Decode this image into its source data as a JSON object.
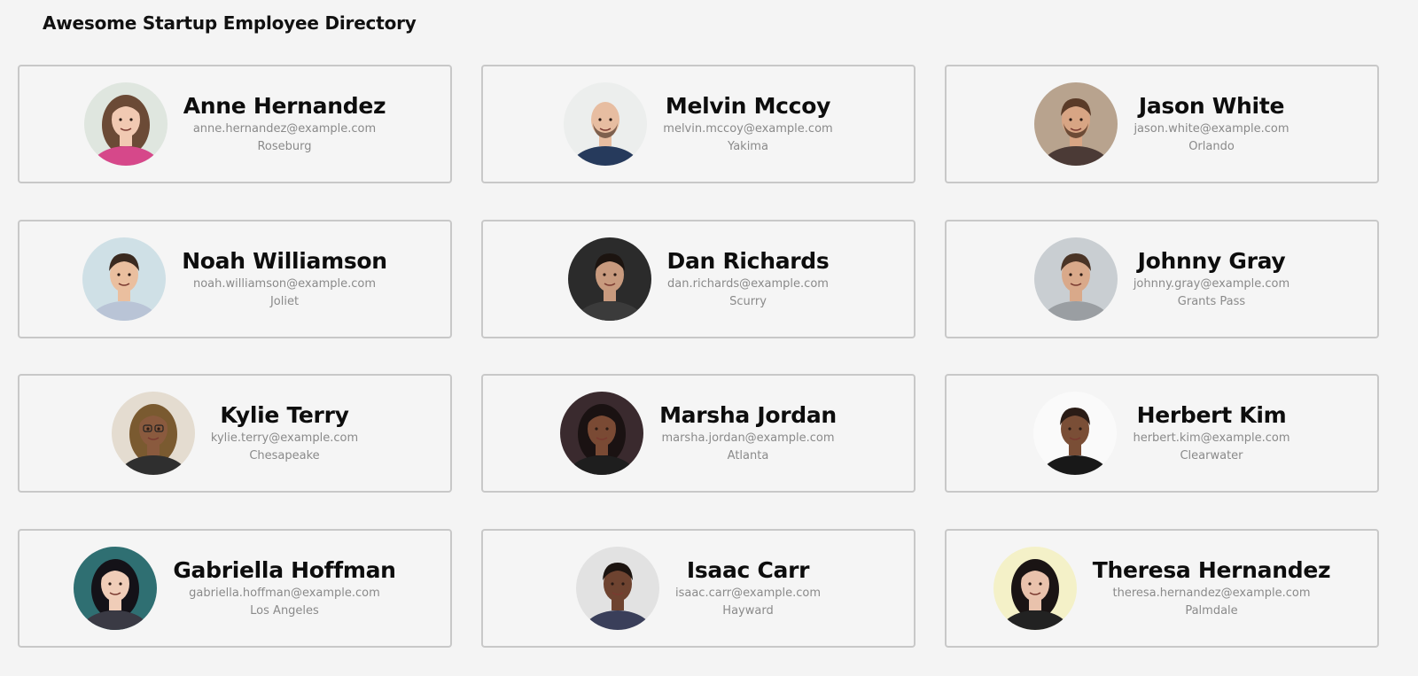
{
  "page": {
    "title": "Awesome Startup Employee Directory"
  },
  "employees": [
    {
      "name": "Anne Hernandez",
      "email": "anne.hernandez@example.com",
      "city": "Roseburg",
      "photo": "woman-pink-jacket-photo",
      "bg": "#dfe6df",
      "skin": "#f1c9b2",
      "hair": "#6b4a36",
      "shirt": "#d6488a"
    },
    {
      "name": "Melvin Mccoy",
      "email": "melvin.mccoy@example.com",
      "city": "Yakima",
      "photo": "bald-man-navy-hoodie-photo",
      "bg": "#eceeed",
      "skin": "#e7bda1",
      "hair": "#e7bda1",
      "shirt": "#263a5c"
    },
    {
      "name": "Jason White",
      "email": "jason.white@example.com",
      "city": "Orlando",
      "photo": "bearded-man-photo",
      "bg": "#b8a38e",
      "skin": "#d8a584",
      "hair": "#5a3b28",
      "shirt": "#4b3a36"
    },
    {
      "name": "Noah Williamson",
      "email": "noah.williamson@example.com",
      "city": "Joliet",
      "photo": "smiling-man-shirt-photo",
      "bg": "#cfe0e6",
      "skin": "#eabf9f",
      "hair": "#3a2a20",
      "shirt": "#b9c4d6"
    },
    {
      "name": "Dan Richards",
      "email": "dan.richards@example.com",
      "city": "Scurry",
      "photo": "man-dark-background-photo",
      "bg": "#2b2b2b",
      "skin": "#c89a7e",
      "hair": "#1c1410",
      "shirt": "#3b3b3b"
    },
    {
      "name": "Johnny Gray",
      "email": "johnny.gray@example.com",
      "city": "Grants Pass",
      "photo": "man-grey-sweater-photo",
      "bg": "#c9ced2",
      "skin": "#d9a98a",
      "hair": "#4a3426",
      "shirt": "#9a9ea2"
    },
    {
      "name": "Kylie Terry",
      "email": "kylie.terry@example.com",
      "city": "Chesapeake",
      "photo": "woman-glasses-photo",
      "bg": "#e4dcd0",
      "skin": "#8a5a3e",
      "hair": "#7a5a30",
      "shirt": "#2f2f2f"
    },
    {
      "name": "Marsha Jordan",
      "email": "marsha.jordan@example.com",
      "city": "Atlanta",
      "photo": "woman-curly-hair-photo",
      "bg": "#3a2a2e",
      "skin": "#7a4a34",
      "hair": "#1a1212",
      "shirt": "#1e1e1e"
    },
    {
      "name": "Herbert Kim",
      "email": "herbert.kim@example.com",
      "city": "Clearwater",
      "photo": "smiling-man-white-background-photo",
      "bg": "#fafafa",
      "skin": "#7a4e36",
      "hair": "#2a1c16",
      "shirt": "#181818"
    },
    {
      "name": "Gabriella Hoffman",
      "email": "gabriella.hoffman@example.com",
      "city": "Los Angeles",
      "photo": "woman-teal-background-photo",
      "bg": "#2f6f72",
      "skin": "#f0cdb8",
      "hair": "#141218",
      "shirt": "#3a3a44"
    },
    {
      "name": "Isaac Carr",
      "email": "isaac.carr@example.com",
      "city": "Hayward",
      "photo": "man-suit-tie-photo",
      "bg": "#e2e2e2",
      "skin": "#6e4330",
      "hair": "#1c1410",
      "shirt": "#3a3f5a"
    },
    {
      "name": "Theresa Hernandez",
      "email": "theresa.hernandez@example.com",
      "city": "Palmdale",
      "photo": "woman-long-hair-photo",
      "bg": "#f4f1c8",
      "skin": "#e9c2ac",
      "hair": "#1a1414",
      "shirt": "#222222"
    }
  ]
}
